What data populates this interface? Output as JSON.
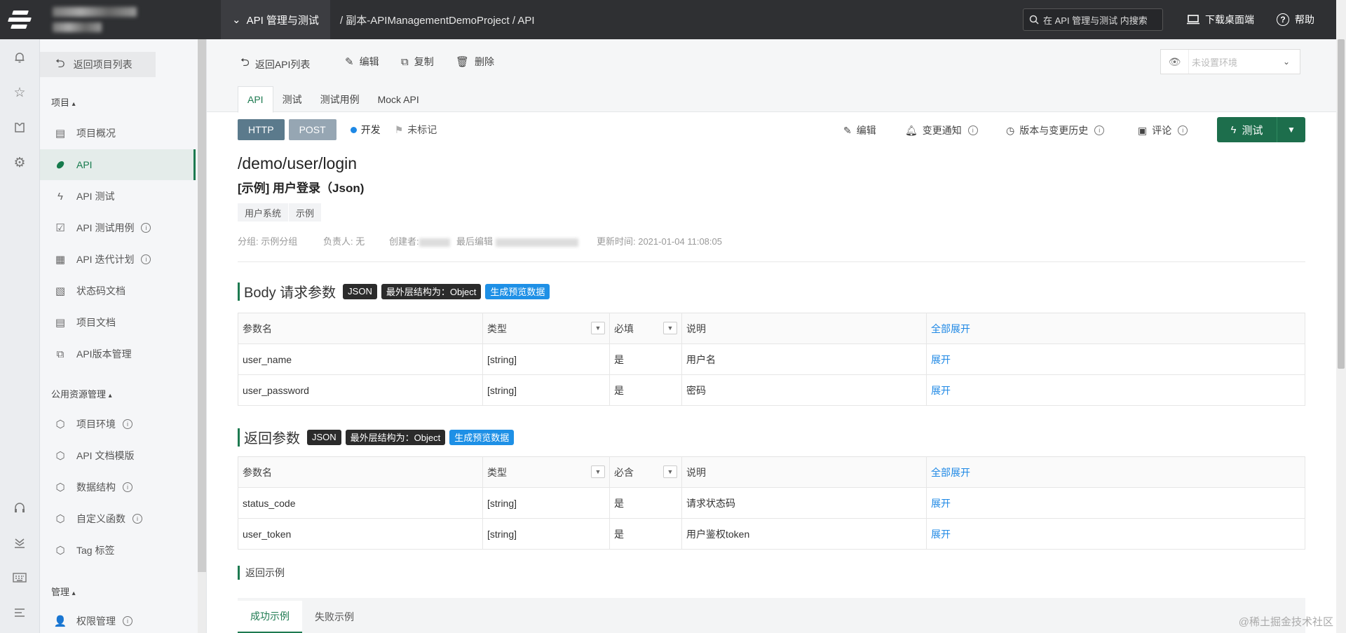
{
  "topbar": {
    "project_menu": "API 管理与测试",
    "breadcrumb": "/  副本-APIManagementDemoProject  /  API",
    "search_placeholder": "在 API 管理与测试 内搜索",
    "download": "下载桌面端",
    "help": "帮助"
  },
  "nav": {
    "back": "返回项目列表",
    "section_project": "项目",
    "section_public": "公用资源管理",
    "section_manage": "管理",
    "items": [
      {
        "label": "项目概况",
        "icon": "dashboard-icon"
      },
      {
        "label": "API",
        "icon": "api-icon"
      },
      {
        "label": "API 测试",
        "icon": "lightning-icon"
      },
      {
        "label": "API 测试用例",
        "icon": "checklist-icon"
      },
      {
        "label": "API 迭代计划",
        "icon": "calendar-icon"
      },
      {
        "label": "状态码文档",
        "icon": "doc-icon"
      },
      {
        "label": "项目文档",
        "icon": "doc-list-icon"
      },
      {
        "label": "API版本管理",
        "icon": "layers-icon"
      },
      {
        "label": "项目环境",
        "icon": "cube-icon"
      },
      {
        "label": "API 文档模版",
        "icon": "cube-icon"
      },
      {
        "label": "数据结构",
        "icon": "cube-icon"
      },
      {
        "label": "自定义函数",
        "icon": "cube-icon"
      },
      {
        "label": "Tag 标签",
        "icon": "cube-icon"
      },
      {
        "label": "权限管理",
        "icon": "user-icon"
      }
    ]
  },
  "toolbar": {
    "back": "返回API列表",
    "edit": "编辑",
    "copy": "复制",
    "delete": "删除",
    "env_placeholder": "未设置环境"
  },
  "tabs": [
    "API",
    "测试",
    "测试用例",
    "Mock API"
  ],
  "api": {
    "protocol": "HTTP",
    "method": "POST",
    "status": "开发",
    "flag": "未标记",
    "path": "/demo/user/login",
    "name": "[示例] 用户登录（Json)",
    "tags": [
      "用户系统",
      "示例"
    ],
    "meta": {
      "group": "分组: 示例分组",
      "owner": "负责人: 无",
      "creator": "创建者:",
      "last_edit": "最后编辑",
      "updated": "更新时间:  2021-01-04 11:08:05"
    }
  },
  "actions": {
    "edit": "编辑",
    "notify": "变更通知",
    "history": "版本与变更历史",
    "comment": "评论",
    "test": "测试"
  },
  "body_params": {
    "title": "Body 请求参数",
    "badge_json": "JSON",
    "badge_struct": "最外层结构为：Object",
    "badge_preview": "生成预览数据",
    "headers": [
      "参数名",
      "类型",
      "必填",
      "说明",
      "全部展开"
    ],
    "rows": [
      {
        "name": "user_name",
        "type": "[string]",
        "required": "是",
        "desc": "用户名",
        "action": "展开"
      },
      {
        "name": "user_password",
        "type": "[string]",
        "required": "是",
        "desc": "密码",
        "action": "展开"
      }
    ]
  },
  "response_params": {
    "title": "返回参数",
    "badge_json": "JSON",
    "badge_struct": "最外层结构为：Object",
    "badge_preview": "生成预览数据",
    "headers": [
      "参数名",
      "类型",
      "必含",
      "说明",
      "全部展开"
    ],
    "rows": [
      {
        "name": "status_code",
        "type": "[string]",
        "required": "是",
        "desc": "请求状态码",
        "action": "展开"
      },
      {
        "name": "user_token",
        "type": "[string]",
        "required": "是",
        "desc": "用户鉴权token",
        "action": "展开"
      }
    ]
  },
  "examples": {
    "title": "返回示例",
    "tabs": [
      "成功示例",
      "失败示例"
    ]
  },
  "watermark": "@稀土掘金技术社区"
}
